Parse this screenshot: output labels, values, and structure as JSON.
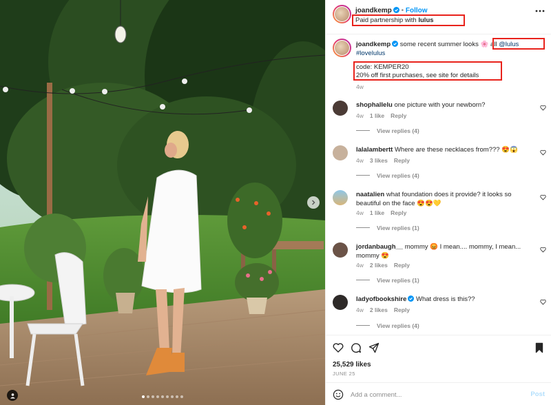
{
  "post": {
    "author": "joandkemp",
    "follow_label": "Follow",
    "partnership_prefix": "Paid partnership with ",
    "partner": "lulus",
    "more_icon": "more-dots-icon"
  },
  "caption": {
    "author": "joandkemp",
    "text": "some recent summer looks",
    "emoji": "🌸",
    "all_word": "all",
    "mention": "@lulus",
    "hashtag": "#lovelulus",
    "code_line": "code: KEMPER20",
    "offer_line": "20% off first purchases, see site for details",
    "time": "4w"
  },
  "comments": [
    {
      "user": "shophallelu",
      "text": "one picture with your newborn?",
      "time": "4w",
      "likes": "1 like",
      "reply": "Reply",
      "view_replies": "View replies (4)"
    },
    {
      "user": "lalalambertt",
      "text": "Where are these necklaces from??? 😍😱",
      "time": "4w",
      "likes": "3 likes",
      "reply": "Reply",
      "view_replies": "View replies (4)"
    },
    {
      "user": "naatalien",
      "text": "what foundation does it provide? it looks so beautiful on the face 😍😍💛",
      "time": "4w",
      "likes": "1 like",
      "reply": "Reply",
      "view_replies": "View replies (1)"
    },
    {
      "user": "jordanbaugh__",
      "text": "mommy 😡 I mean.... mommy, I mean... mommy 😍",
      "time": "4w",
      "likes": "2 likes",
      "reply": "Reply",
      "view_replies": "View replies (1)"
    },
    {
      "user": "ladyofbookshire",
      "text": "What dress is this??",
      "time": "4w",
      "likes": "2 likes",
      "reply": "Reply",
      "view_replies": "View replies (4)"
    }
  ],
  "footer": {
    "likes": "25,529 likes",
    "date": "JUNE 25",
    "comment_placeholder": "Add a comment...",
    "post_label": "Post"
  },
  "colors": {
    "accent": "#0095f6",
    "highlight_box": "#e8221b",
    "text": "#262626",
    "muted": "#8e8e8e"
  }
}
